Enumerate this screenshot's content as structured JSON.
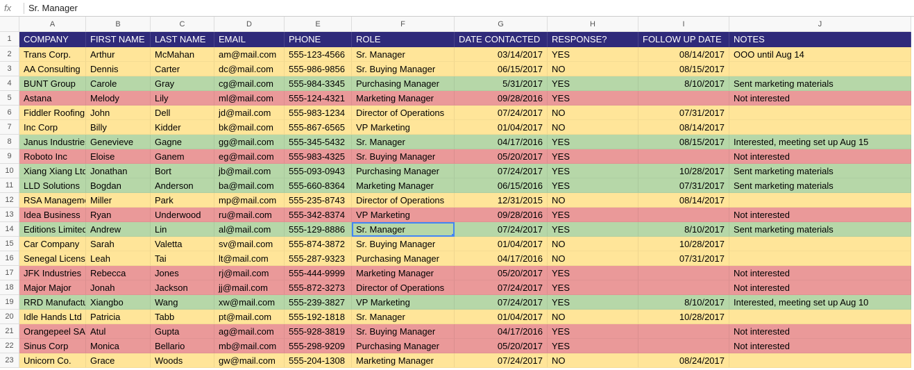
{
  "formula_bar": {
    "fx": "fx",
    "value": "Sr. Manager"
  },
  "columns": [
    "A",
    "B",
    "C",
    "D",
    "E",
    "F",
    "G",
    "H",
    "I",
    "J"
  ],
  "col_keys": [
    "company",
    "first",
    "last",
    "email",
    "phone",
    "role",
    "contacted",
    "response",
    "follow",
    "notes"
  ],
  "num_cols": [
    "contacted",
    "follow"
  ],
  "headers": {
    "company": "COMPANY",
    "first": "FIRST NAME",
    "last": "LAST NAME",
    "email": "EMAIL",
    "phone": "PHONE",
    "role": "ROLE",
    "contacted": "DATE CONTACTED",
    "response": "RESPONSE?",
    "follow": "FOLLOW UP DATE",
    "notes": "NOTES"
  },
  "selection": {
    "row_index": 12,
    "col_key": "role"
  },
  "rows": [
    {
      "color": "yellow",
      "company": "Trans Corp.",
      "first": "Arthur",
      "last": "McMahan",
      "email": "am@mail.com",
      "phone": "555-123-4566",
      "role": "Sr. Manager",
      "contacted": "03/14/2017",
      "response": "YES",
      "follow": "08/14/2017",
      "notes": "OOO until Aug 14"
    },
    {
      "color": "yellow",
      "company": "AA Consulting",
      "first": "Dennis",
      "last": "Carter",
      "email": "dc@mail.com",
      "phone": "555-986-9856",
      "role": "Sr. Buying Manager",
      "contacted": "06/15/2017",
      "response": "NO",
      "follow": "08/15/2017",
      "notes": ""
    },
    {
      "color": "green",
      "company": "BUNT Group",
      "first": "Carole",
      "last": "Gray",
      "email": "cg@mail.com",
      "phone": "555-984-3345",
      "role": "Purchasing Manager",
      "contacted": "5/31/2017",
      "response": "YES",
      "follow": "8/10/2017",
      "notes": "Sent marketing materials"
    },
    {
      "color": "red",
      "company": "Astana",
      "first": "Melody",
      "last": "Lily",
      "email": "ml@mail.com",
      "phone": "555-124-4321",
      "role": "Marketing Manager",
      "contacted": "09/28/2016",
      "response": "YES",
      "follow": "",
      "notes": "Not interested"
    },
    {
      "color": "yellow",
      "company": "Fiddler Roofing",
      "first": "John",
      "last": "Dell",
      "email": "jd@mail.com",
      "phone": "555-983-1234",
      "role": "Director of Operations",
      "contacted": "07/24/2017",
      "response": "NO",
      "follow": "07/31/2017",
      "notes": ""
    },
    {
      "color": "yellow",
      "company": "Inc Corp",
      "first": "Billy",
      "last": "Kidder",
      "email": "bk@mail.com",
      "phone": "555-867-6565",
      "role": "VP Marketing",
      "contacted": "01/04/2017",
      "response": "NO",
      "follow": "08/14/2017",
      "notes": ""
    },
    {
      "color": "green",
      "company": "Janus Industries",
      "first": "Genevieve",
      "last": "Gagne",
      "email": "gg@mail.com",
      "phone": "555-345-5432",
      "role": "Sr. Manager",
      "contacted": "04/17/2016",
      "response": "YES",
      "follow": "08/15/2017",
      "notes": "Interested, meeting set up Aug 15"
    },
    {
      "color": "red",
      "company": "Roboto Inc",
      "first": "Eloise",
      "last": "Ganem",
      "email": "eg@mail.com",
      "phone": "555-983-4325",
      "role": "Sr. Buying Manager",
      "contacted": "05/20/2017",
      "response": "YES",
      "follow": "",
      "notes": "Not interested"
    },
    {
      "color": "green",
      "company": "Xiang Xiang Ltd",
      "first": "Jonathan",
      "last": "Bort",
      "email": "jb@mail.com",
      "phone": "555-093-0943",
      "role": "Purchasing Manager",
      "contacted": "07/24/2017",
      "response": "YES",
      "follow": "10/28/2017",
      "notes": "Sent marketing materials"
    },
    {
      "color": "green",
      "company": "LLD Solutions",
      "first": "Bogdan",
      "last": "Anderson",
      "email": "ba@mail.com",
      "phone": "555-660-8364",
      "role": "Marketing Manager",
      "contacted": "06/15/2016",
      "response": "YES",
      "follow": "07/31/2017",
      "notes": "Sent marketing materials"
    },
    {
      "color": "yellow",
      "company": "RSA Management",
      "first": "Miller",
      "last": "Park",
      "email": "mp@mail.com",
      "phone": "555-235-8743",
      "role": "Director of Operations",
      "contacted": "12/31/2015",
      "response": "NO",
      "follow": "08/14/2017",
      "notes": ""
    },
    {
      "color": "red",
      "company": "Idea Business",
      "first": "Ryan",
      "last": "Underwood",
      "email": "ru@mail.com",
      "phone": "555-342-8374",
      "role": "VP Marketing",
      "contacted": "09/28/2016",
      "response": "YES",
      "follow": "",
      "notes": "Not interested"
    },
    {
      "color": "green",
      "company": "Editions Limited",
      "first": "Andrew",
      "last": "Lin",
      "email": "al@mail.com",
      "phone": "555-129-8886",
      "role": "Sr. Manager",
      "contacted": "07/24/2017",
      "response": "YES",
      "follow": "8/10/2017",
      "notes": "Sent marketing materials"
    },
    {
      "color": "yellow",
      "company": "Car Company",
      "first": "Sarah",
      "last": "Valetta",
      "email": "sv@mail.com",
      "phone": "555-874-3872",
      "role": "Sr. Buying Manager",
      "contacted": "01/04/2017",
      "response": "NO",
      "follow": "10/28/2017",
      "notes": ""
    },
    {
      "color": "yellow",
      "company": "Senegal Licensing",
      "first": "Leah",
      "last": "Tai",
      "email": "lt@mail.com",
      "phone": "555-287-9323",
      "role": "Purchasing Manager",
      "contacted": "04/17/2016",
      "response": "NO",
      "follow": "07/31/2017",
      "notes": ""
    },
    {
      "color": "red",
      "company": "JFK Industries",
      "first": "Rebecca",
      "last": "Jones",
      "email": "rj@mail.com",
      "phone": "555-444-9999",
      "role": "Marketing Manager",
      "contacted": "05/20/2017",
      "response": "YES",
      "follow": "",
      "notes": "Not interested"
    },
    {
      "color": "red",
      "company": "Major Major",
      "first": "Jonah",
      "last": "Jackson",
      "email": "jj@mail.com",
      "phone": "555-872-3273",
      "role": "Director of Operations",
      "contacted": "07/24/2017",
      "response": "YES",
      "follow": "",
      "notes": "Not interested"
    },
    {
      "color": "green",
      "company": "RRD Manufacturing",
      "first": "Xiangbo",
      "last": "Wang",
      "email": "xw@mail.com",
      "phone": "555-239-3827",
      "role": "VP Marketing",
      "contacted": "07/24/2017",
      "response": "YES",
      "follow": "8/10/2017",
      "notes": "Interested, meeting set up Aug 10"
    },
    {
      "color": "yellow",
      "company": "Idle Hands Ltd",
      "first": "Patricia",
      "last": "Tabb",
      "email": "pt@mail.com",
      "phone": "555-192-1818",
      "role": "Sr. Manager",
      "contacted": "01/04/2017",
      "response": "NO",
      "follow": "10/28/2017",
      "notes": ""
    },
    {
      "color": "red",
      "company": "Orangepeel SA",
      "first": "Atul",
      "last": "Gupta",
      "email": "ag@mail.com",
      "phone": "555-928-3819",
      "role": "Sr. Buying Manager",
      "contacted": "04/17/2016",
      "response": "YES",
      "follow": "",
      "notes": "Not interested"
    },
    {
      "color": "red",
      "company": "Sinus Corp",
      "first": "Monica",
      "last": "Bellario",
      "email": "mb@mail.com",
      "phone": "555-298-9209",
      "role": "Purchasing Manager",
      "contacted": "05/20/2017",
      "response": "YES",
      "follow": "",
      "notes": "Not interested"
    },
    {
      "color": "yellow",
      "company": "Unicorn Co.",
      "first": "Grace",
      "last": "Woods",
      "email": "gw@mail.com",
      "phone": "555-204-1308",
      "role": "Marketing Manager",
      "contacted": "07/24/2017",
      "response": "NO",
      "follow": "08/24/2017",
      "notes": ""
    }
  ]
}
